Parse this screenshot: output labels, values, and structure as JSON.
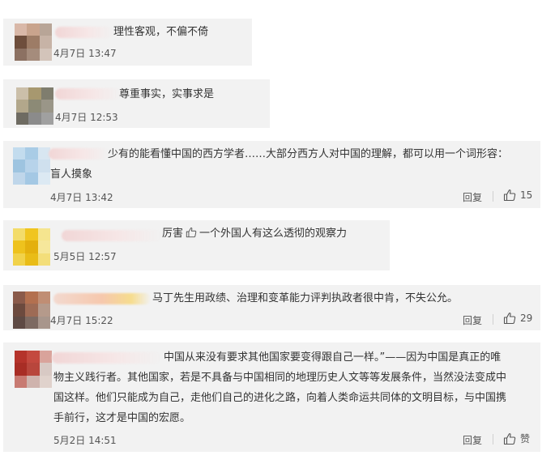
{
  "comments": [
    {
      "text": "理性客观，不偏不倚",
      "time": "4月7日 13:47",
      "avatar_colors": [
        "#d9b8a8",
        "#c9a48d",
        "#b8a597",
        "#6e4e3c",
        "#9d7c66",
        "#c7b3a6",
        "#8c7162",
        "#a58c7c",
        "#d3c4ba"
      ]
    },
    {
      "text": "尊重事实，实事求是",
      "time": "4月7日 12:53",
      "avatar_colors": [
        "#cbbfa9",
        "#a7986f",
        "#7f7d6e",
        "#b2a78b",
        "#8c8a76",
        "#9a9688",
        "#6e6b62",
        "#8b8b8b",
        "#a0a0a0"
      ]
    },
    {
      "text_lines": [
        "少有的能看懂中国的西方学者……大部分西方人对中国的理解，都可以用一个词形容：",
        "盲人摸象"
      ],
      "time": "4月7日 13:42",
      "reply": "回复",
      "likes": "15",
      "avatar_colors": [
        "#c3dcee",
        "#a9cce6",
        "#d8e6f1",
        "#9ec4e0",
        "#b7d3ea",
        "#cfe0ee",
        "#bfd6ea",
        "#a4c8e4",
        "#dce9f3"
      ]
    },
    {
      "text_before": "厉害",
      "text_after": "一个外国人有这么透彻的观察力",
      "time": "5月5日 12:57",
      "avatar_colors": [
        "#f3dc6a",
        "#f0c520",
        "#f5e58f",
        "#eec21d",
        "#e4b00e",
        "#f6e79b",
        "#f1d24a",
        "#e9bc17",
        "#f3de7a"
      ]
    },
    {
      "text": "马丁先生用政绩、治理和变革能力评判执政者很中肯，不失公允。",
      "time": "4月7日 15:22",
      "reply": "回复",
      "likes": "29",
      "avatar_colors": [
        "#8a5a4a",
        "#b3704f",
        "#c08e74",
        "#6c4a3e",
        "#9e6b55",
        "#b59a8b",
        "#5e4a44",
        "#7d6a62",
        "#a8968c"
      ]
    },
    {
      "text_lines": [
        "中国从来没有要求其他国家要变得跟自己一样。”——因为中国是真正的唯",
        "物主义践行者。其他国家，若是不具备与中国相同的地理历史人文等等发展条件，当然没法变成中",
        "国这样。他们只能成为自己，走他们自己的进化之路，向着人类命运共同体的文明目标，与中国携",
        "手前行，这才是中国的宏愿。"
      ],
      "time": "5月2日 14:51",
      "reply": "回复",
      "likes": "赞",
      "avatar_colors": [
        "#b5332b",
        "#c4493f",
        "#d9a39b",
        "#a82d25",
        "#b8463c",
        "#d8c9c4",
        "#c87a72",
        "#cfb3ad",
        "#e0d2cc"
      ]
    }
  ]
}
